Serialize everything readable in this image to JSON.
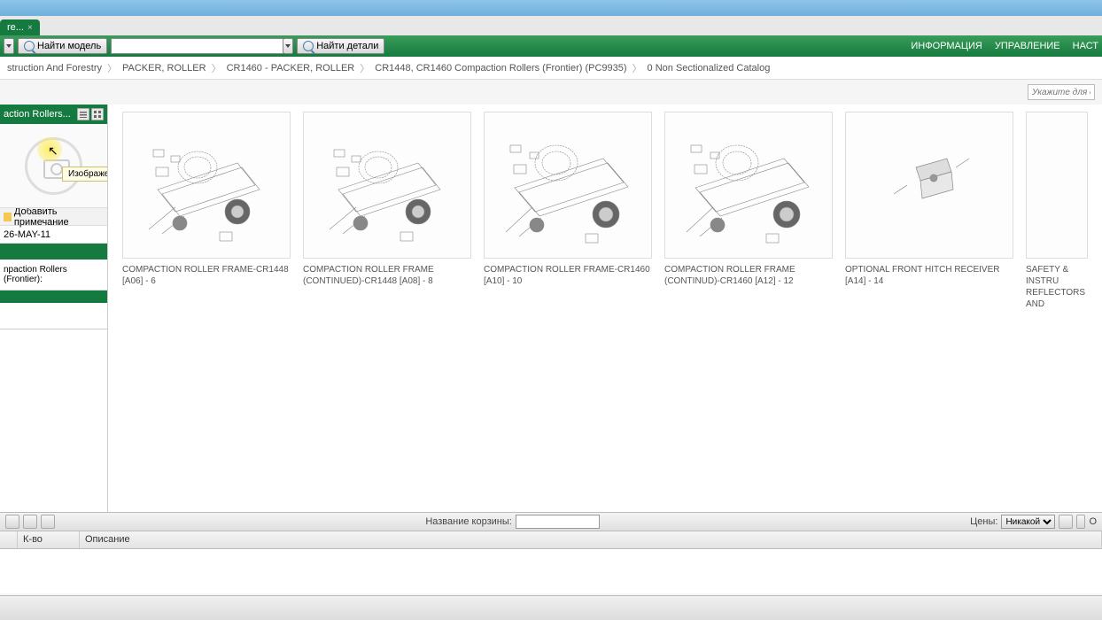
{
  "tab": {
    "label": "re...",
    "close": "×"
  },
  "toolbar": {
    "find_model": "Найти модель",
    "find_parts": "Найти детали",
    "model_input": "",
    "menu": {
      "info": "ИНФОРМАЦИЯ",
      "manage": "УПРАВЛЕНИЕ",
      "settings": "НАСТ"
    }
  },
  "breadcrumb": {
    "items": [
      "struction And Forestry",
      "PACKER, ROLLER",
      "CR1460 - PACKER, ROLLER",
      "CR1448, CR1460 Compaction Rollers (Frontier) (PC9935)",
      "0 Non Sectionalized Catalog"
    ]
  },
  "filter": {
    "placeholder": "Укажите для огр"
  },
  "sidebar": {
    "title": "action Rollers...",
    "tooltip": "Изображение недоступно",
    "add_note": "Добавить примечание",
    "date": "26-MAY-11",
    "content_row": "npaction Rollers (Frontier):"
  },
  "parts": [
    {
      "label": "COMPACTION ROLLER FRAME-CR1448 [A06] - 6"
    },
    {
      "label": "COMPACTION ROLLER FRAME (CONTINUED)-CR1448 [A08] - 8"
    },
    {
      "label": "COMPACTION ROLLER FRAME-CR1460 [A10] - 10"
    },
    {
      "label": "COMPACTION ROLLER FRAME (CONTINUD)-CR1460 [A12] - 12"
    },
    {
      "label": "OPTIONAL FRONT HITCH RECEIVER [A14] - 14"
    },
    {
      "label": "SAFETY & INSTRU REFLECTORS AND"
    }
  ],
  "cart": {
    "name_label": "Название корзины:",
    "name_value": "",
    "price_label": "Цены:",
    "price_value": "Никакой",
    "last": "О"
  },
  "table": {
    "qty": "К-во",
    "desc": "Описание"
  }
}
